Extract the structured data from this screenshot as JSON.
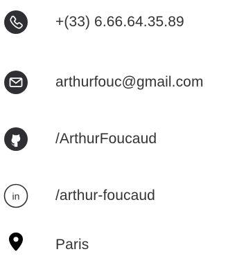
{
  "contacts": {
    "phone": {
      "text": "+(33) 6.66.64.35.89",
      "icon": "phone-icon"
    },
    "email": {
      "text": "arthurfouc@gmail.com",
      "icon": "envelope-icon"
    },
    "github": {
      "text": "/ArthurFoucaud",
      "icon": "github-icon"
    },
    "linkedin": {
      "text": "/arthur-foucaud",
      "icon": "linkedin-icon"
    },
    "location": {
      "text": "Paris",
      "icon": "map-pin-icon"
    }
  },
  "colors": {
    "icon_fill": "#2f3033",
    "text": "#333333",
    "background": "#ffffff"
  }
}
